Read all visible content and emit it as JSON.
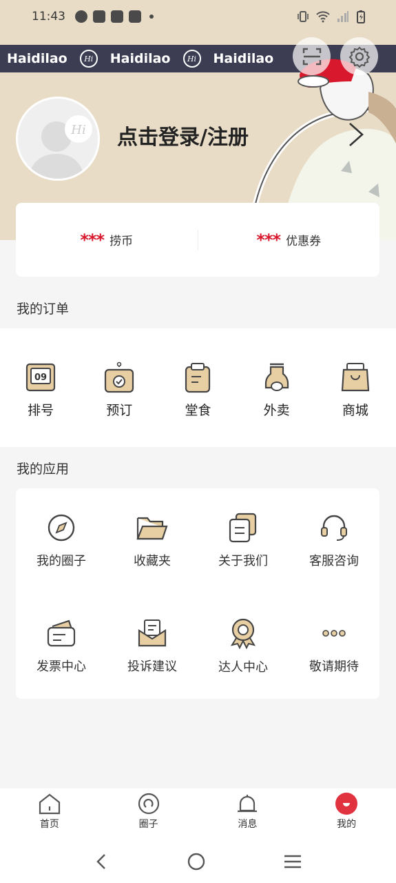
{
  "status_bar": {
    "time": "11:43"
  },
  "header": {
    "brand": [
      "Haidilao",
      "Haidilao",
      "Haidilao"
    ],
    "brand_logo": "Hi",
    "login_text": "点击登录/注册",
    "scan_icon": "scan-icon",
    "settings_icon": "gear-icon"
  },
  "points": [
    {
      "value": "***",
      "label": "捞币"
    },
    {
      "value": "***",
      "label": "优惠券"
    }
  ],
  "orders": {
    "title": "我的订单",
    "items": [
      {
        "label": "排号",
        "icon": "queue-number-icon",
        "badge": "09"
      },
      {
        "label": "预订",
        "icon": "reservation-icon"
      },
      {
        "label": "堂食",
        "icon": "dine-in-icon"
      },
      {
        "label": "外卖",
        "icon": "delivery-scooter-icon"
      },
      {
        "label": "商城",
        "icon": "shopping-bag-icon"
      }
    ]
  },
  "apps": {
    "title": "我的应用",
    "items": [
      {
        "label": "我的圈子",
        "icon": "compass-icon"
      },
      {
        "label": "收藏夹",
        "icon": "folder-icon"
      },
      {
        "label": "关于我们",
        "icon": "document-icon"
      },
      {
        "label": "客服咨询",
        "icon": "headset-icon"
      },
      {
        "label": "发票中心",
        "icon": "invoice-icon"
      },
      {
        "label": "投诉建议",
        "icon": "mail-icon"
      },
      {
        "label": "达人中心",
        "icon": "award-icon"
      },
      {
        "label": "敬请期待",
        "icon": "more-icon"
      }
    ]
  },
  "bottom_nav": [
    {
      "label": "首页",
      "icon": "home-icon"
    },
    {
      "label": "圈子",
      "icon": "circle-icon"
    },
    {
      "label": "消息",
      "icon": "bell-icon"
    },
    {
      "label": "我的",
      "icon": "profile-icon",
      "active": true
    }
  ],
  "colors": {
    "accent": "#d8182c",
    "tan": "#e8cfa3",
    "brand_strip": "#3c3d53",
    "header_bg": "#e8dcc6"
  }
}
